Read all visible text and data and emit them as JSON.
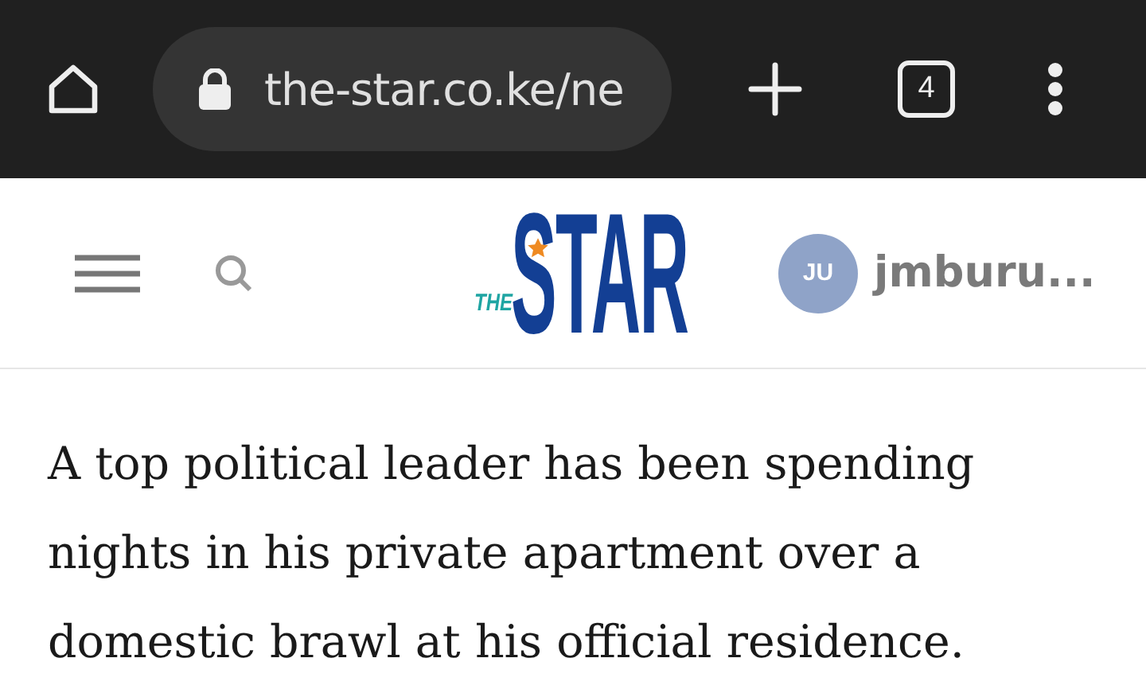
{
  "browser": {
    "url": "the-star.co.ke/ne",
    "tab_count": "4"
  },
  "header": {
    "logo": {
      "small": "THE",
      "main": "STAR"
    },
    "avatar_initials": "JU",
    "username": "jmburu..."
  },
  "article": {
    "text": "A top political leader has been spending nights in his private apartment over a domestic brawl at his official residence."
  }
}
